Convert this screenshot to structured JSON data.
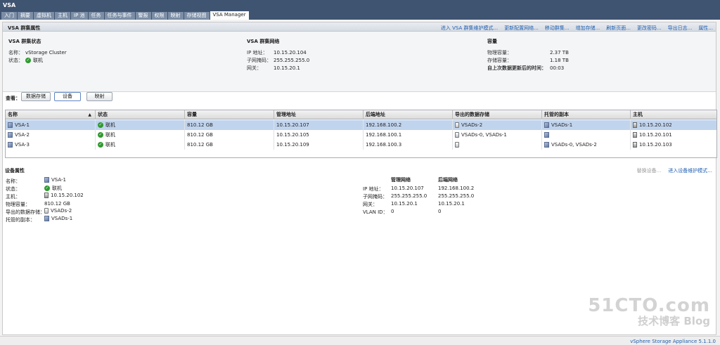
{
  "app_title": "VSA",
  "tabs": [
    "入门",
    "摘要",
    "虚拟机",
    "主机",
    "IP 池",
    "任务",
    "任务与事件",
    "警报",
    "权限",
    "映射",
    "存储视图",
    "VSA Manager"
  ],
  "active_tab": 11,
  "cluster_props": {
    "title": "VSA 群集属性",
    "actions": [
      "进入 VSA 群集维护模式...",
      "更新配置网络...",
      "移动群集...",
      "增加存储...",
      "刷新页面...",
      "更改密码...",
      "导出日志...",
      "属性..."
    ],
    "status": {
      "title": "VSA 群集状态",
      "name_label": "名称：",
      "name_value": "vStorage Cluster",
      "state_label": "状态：",
      "state_value": "联机"
    },
    "network": {
      "title": "VSA 群集网络",
      "ip_label": "IP 地址：",
      "ip_value": "10.15.20.104",
      "mask_label": "子网掩码：",
      "mask_value": "255.255.255.0",
      "gw_label": "网关：",
      "gw_value": "10.15.20.1"
    },
    "capacity": {
      "title": "容量",
      "phys_label": "物理容量：",
      "phys_value": "2.37 TB",
      "store_label": "存储容量：",
      "store_value": "1.18 TB",
      "updated_label": "自上次数据更新后的时间：",
      "updated_value": "00:03"
    }
  },
  "view": {
    "label": "查看：",
    "buttons": [
      "数据存储",
      "设备",
      "映射"
    ],
    "active": 1
  },
  "grid": {
    "columns": [
      "名称",
      "状态",
      "容量",
      "管理地址",
      "后端地址",
      "导出的数据存储",
      "托管的副本",
      "主机"
    ],
    "sort_indicator": "▲",
    "rows": [
      {
        "name": "VSA-1",
        "status": "联机",
        "capacity": "810.12 GB",
        "mgmt": "10.15.20.107",
        "backend": "192.168.100.2",
        "exported": "VSADs-2",
        "replica": "VSADs-1",
        "host": "10.15.20.102"
      },
      {
        "name": "VSA-2",
        "status": "联机",
        "capacity": "810.12 GB",
        "mgmt": "10.15.20.105",
        "backend": "192.168.100.1",
        "exported": "VSADs-0, VSADs-1",
        "replica": "",
        "host": "10.15.20.101"
      },
      {
        "name": "VSA-3",
        "status": "联机",
        "capacity": "810.12 GB",
        "mgmt": "10.15.20.109",
        "backend": "192.168.100.3",
        "exported": "",
        "replica": "VSADs-0, VSADs-2",
        "host": "10.15.20.103"
      }
    ],
    "selected_row": 0
  },
  "device": {
    "title": "设备属性",
    "actions_disabled": "替换设备...",
    "actions_link": "进入设备维护模式...",
    "name_label": "名称：",
    "name_value": "VSA-1",
    "state_label": "状态：",
    "state_value": "联机",
    "host_label": "主机：",
    "host_value": "10.15.20.102",
    "phys_label": "物理容量：",
    "phys_value": "810.12 GB",
    "exported_label": "导出的数据存储：",
    "exported_value": "VSADs-2",
    "replica_label": "托管的副本：",
    "replica_value": "VSADs-1",
    "net_front_header": "管理网络",
    "net_back_header": "后端网络",
    "ip_label": "IP 地址：",
    "ip_front": "10.15.20.107",
    "ip_back": "192.168.100.2",
    "mask_label": "子网掩码：",
    "mask_front": "255.255.255.0",
    "mask_back": "255.255.255.0",
    "gw_label": "网关：",
    "gw_front": "10.15.20.1",
    "gw_back": "10.15.20.1",
    "vlan_label": "VLAN ID：",
    "vlan_front": "0",
    "vlan_back": "0"
  },
  "watermark": {
    "line1": "51CTO.com",
    "line2": "技术博客  Blog"
  },
  "footer": "vSphere Storage Appliance 5.1.1.0",
  "colors": {
    "header": "#3f5470",
    "link": "#1f5fb0",
    "selected_row": "#c1d4ee",
    "ok": "#2f9a2f"
  }
}
